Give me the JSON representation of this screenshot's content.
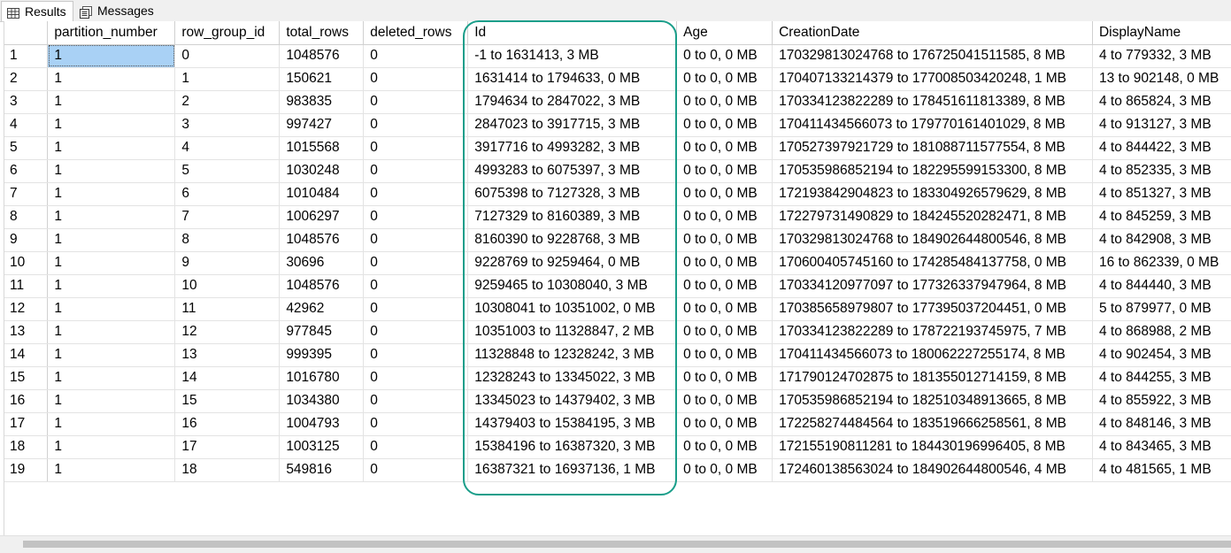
{
  "tabs": [
    {
      "label": "Results",
      "icon": "grid-icon",
      "active": true
    },
    {
      "label": "Messages",
      "icon": "messages-icon",
      "active": false
    }
  ],
  "columns": [
    "partition_number",
    "row_group_id",
    "total_rows",
    "deleted_rows",
    "Id",
    "Age",
    "CreationDate",
    "DisplayName"
  ],
  "rows": [
    {
      "n": "1",
      "c": [
        "1",
        "0",
        "1048576",
        "0",
        "-1 to 1631413, 3 MB",
        "0 to 0, 0 MB",
        "170329813024768 to 176725041511585, 8 MB",
        "4 to 779332, 3 MB"
      ]
    },
    {
      "n": "2",
      "c": [
        "1",
        "1",
        "150621",
        "0",
        "1631414 to 1794633, 0 MB",
        "0 to 0, 0 MB",
        "170407133214379 to 177008503420248, 1 MB",
        "13 to 902148, 0 MB"
      ]
    },
    {
      "n": "3",
      "c": [
        "1",
        "2",
        "983835",
        "0",
        "1794634 to 2847022, 3 MB",
        "0 to 0, 0 MB",
        "170334123822289 to 178451611813389, 8 MB",
        "4 to 865824, 3 MB"
      ]
    },
    {
      "n": "4",
      "c": [
        "1",
        "3",
        "997427",
        "0",
        "2847023 to 3917715, 3 MB",
        "0 to 0, 0 MB",
        "170411434566073 to 179770161401029, 8 MB",
        "4 to 913127, 3 MB"
      ]
    },
    {
      "n": "5",
      "c": [
        "1",
        "4",
        "1015568",
        "0",
        "3917716 to 4993282, 3 MB",
        "0 to 0, 0 MB",
        "170527397921729 to 181088711577554, 8 MB",
        "4 to 844422, 3 MB"
      ]
    },
    {
      "n": "6",
      "c": [
        "1",
        "5",
        "1030248",
        "0",
        "4993283 to 6075397, 3 MB",
        "0 to 0, 0 MB",
        "170535986852194 to 182295599153300, 8 MB",
        "4 to 852335, 3 MB"
      ]
    },
    {
      "n": "7",
      "c": [
        "1",
        "6",
        "1010484",
        "0",
        "6075398 to 7127328, 3 MB",
        "0 to 0, 0 MB",
        "172193842904823 to 183304926579629, 8 MB",
        "4 to 851327, 3 MB"
      ]
    },
    {
      "n": "8",
      "c": [
        "1",
        "7",
        "1006297",
        "0",
        "7127329 to 8160389, 3 MB",
        "0 to 0, 0 MB",
        "172279731490829 to 184245520282471, 8 MB",
        "4 to 845259, 3 MB"
      ]
    },
    {
      "n": "9",
      "c": [
        "1",
        "8",
        "1048576",
        "0",
        "8160390 to 9228768, 3 MB",
        "0 to 0, 0 MB",
        "170329813024768 to 184902644800546, 8 MB",
        "4 to 842908, 3 MB"
      ]
    },
    {
      "n": "10",
      "c": [
        "1",
        "9",
        "30696",
        "0",
        "9228769 to 9259464, 0 MB",
        "0 to 0, 0 MB",
        "170600405745160 to 174285484137758, 0 MB",
        "16 to 862339, 0 MB"
      ]
    },
    {
      "n": "11",
      "c": [
        "1",
        "10",
        "1048576",
        "0",
        "9259465 to 10308040, 3 MB",
        "0 to 0, 0 MB",
        "170334120977097 to 177326337947964, 8 MB",
        "4 to 844440, 3 MB"
      ]
    },
    {
      "n": "12",
      "c": [
        "1",
        "11",
        "42962",
        "0",
        "10308041 to 10351002, 0 MB",
        "0 to 0, 0 MB",
        "170385658979807 to 177395037204451, 0 MB",
        "5 to 879977, 0 MB"
      ]
    },
    {
      "n": "13",
      "c": [
        "1",
        "12",
        "977845",
        "0",
        "10351003 to 11328847, 2 MB",
        "0 to 0, 0 MB",
        "170334123822289 to 178722193745975, 7 MB",
        "4 to 868988, 2 MB"
      ]
    },
    {
      "n": "14",
      "c": [
        "1",
        "13",
        "999395",
        "0",
        "11328848 to 12328242, 3 MB",
        "0 to 0, 0 MB",
        "170411434566073 to 180062227255174, 8 MB",
        "4 to 902454, 3 MB"
      ]
    },
    {
      "n": "15",
      "c": [
        "1",
        "14",
        "1016780",
        "0",
        "12328243 to 13345022, 3 MB",
        "0 to 0, 0 MB",
        "171790124702875 to 181355012714159, 8 MB",
        "4 to 844255, 3 MB"
      ]
    },
    {
      "n": "16",
      "c": [
        "1",
        "15",
        "1034380",
        "0",
        "13345023 to 14379402, 3 MB",
        "0 to 0, 0 MB",
        "170535986852194 to 182510348913665, 8 MB",
        "4 to 855922, 3 MB"
      ]
    },
    {
      "n": "17",
      "c": [
        "1",
        "16",
        "1004793",
        "0",
        "14379403 to 15384195, 3 MB",
        "0 to 0, 0 MB",
        "172258274484564 to 183519666258561, 8 MB",
        "4 to 848146, 3 MB"
      ]
    },
    {
      "n": "18",
      "c": [
        "1",
        "17",
        "1003125",
        "0",
        "15384196 to 16387320, 3 MB",
        "0 to 0, 0 MB",
        "172155190811281 to 184430196996405, 8 MB",
        "4 to 843465, 3 MB"
      ]
    },
    {
      "n": "19",
      "c": [
        "1",
        "18",
        "549816",
        "0",
        "16387321 to 16937136, 1 MB",
        "0 to 0, 0 MB",
        "172460138563024 to 184902644800546, 4 MB",
        "4 to 481565, 1 MB"
      ]
    }
  ],
  "selected_cell": {
    "row": 0,
    "col": 0
  },
  "highlight_color": "#1a9e8a",
  "selection_color": "#a9d1f5"
}
